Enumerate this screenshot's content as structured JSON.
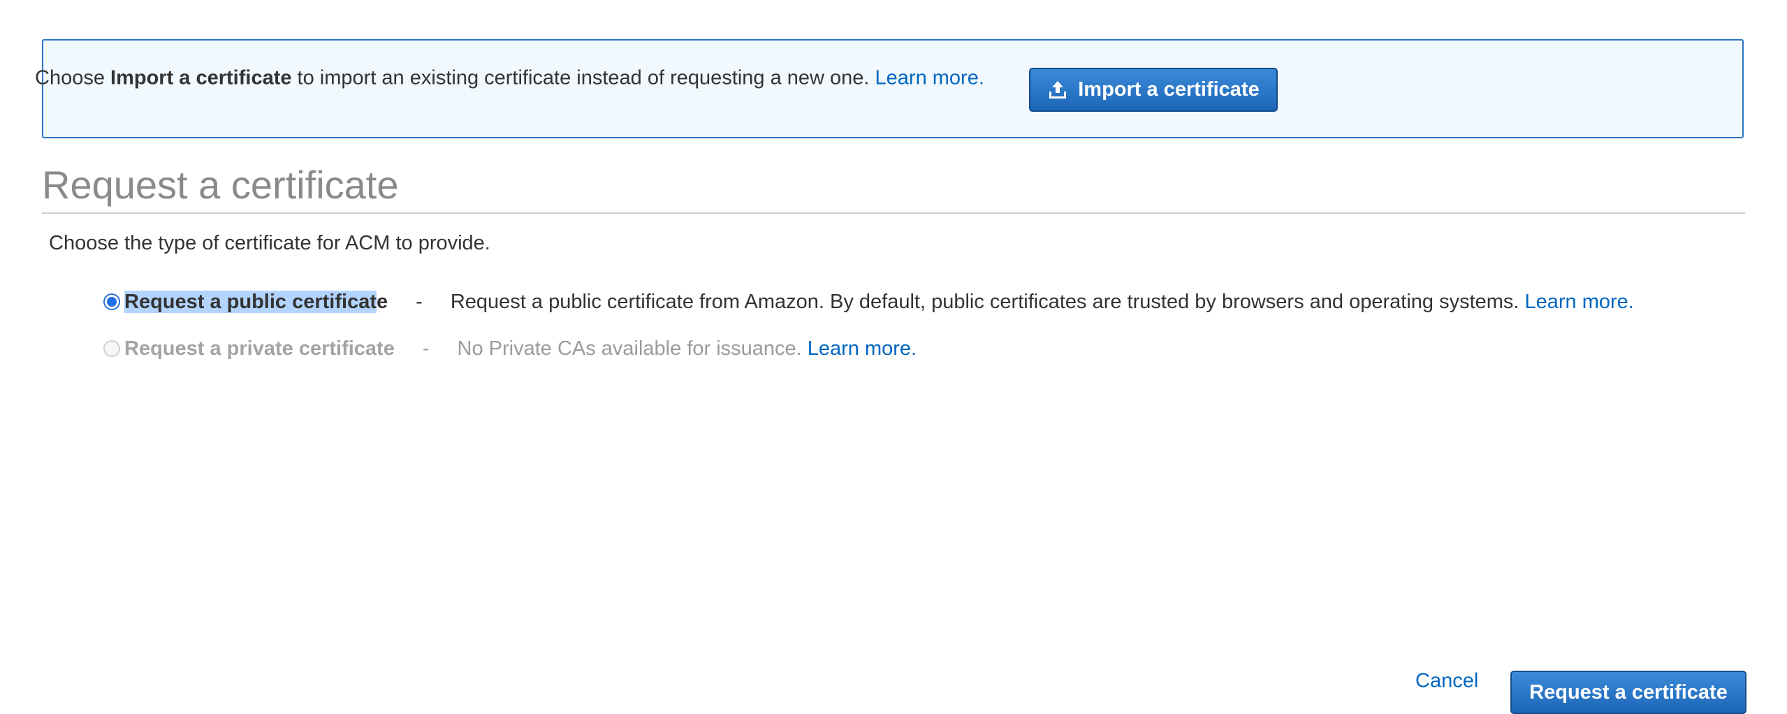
{
  "banner": {
    "text_prefix": "Choose ",
    "text_bold": "Import a certificate",
    "text_suffix": " to import an existing certificate instead of requesting a new one. ",
    "learn_more": "Learn more.",
    "import_button_label": "Import a certificate",
    "import_button_icon": "upload-icon"
  },
  "page": {
    "title": "Request a certificate",
    "subtitle": "Choose the type of certificate for ACM to provide."
  },
  "options": [
    {
      "label_highlighted": "Request a public certificat",
      "label_rest": "e",
      "dash": "-",
      "description": "Request a public certificate from Amazon. By default, public certificates are trusted by browsers and operating systems.",
      "learn_more": "Learn more.",
      "selected": true,
      "enabled": true
    },
    {
      "label": "Request a private certificate",
      "dash": "-",
      "description": "No Private CAs available for issuance.",
      "learn_more": "Learn more.",
      "selected": false,
      "enabled": false
    }
  ],
  "footer": {
    "cancel_label": "Cancel",
    "submit_label": "Request a certificate"
  },
  "colors": {
    "accent_blue": "#1d66b7",
    "link_blue": "#0066c0",
    "banner_bg": "#f1f8fe",
    "banner_border": "#2b76c4"
  }
}
